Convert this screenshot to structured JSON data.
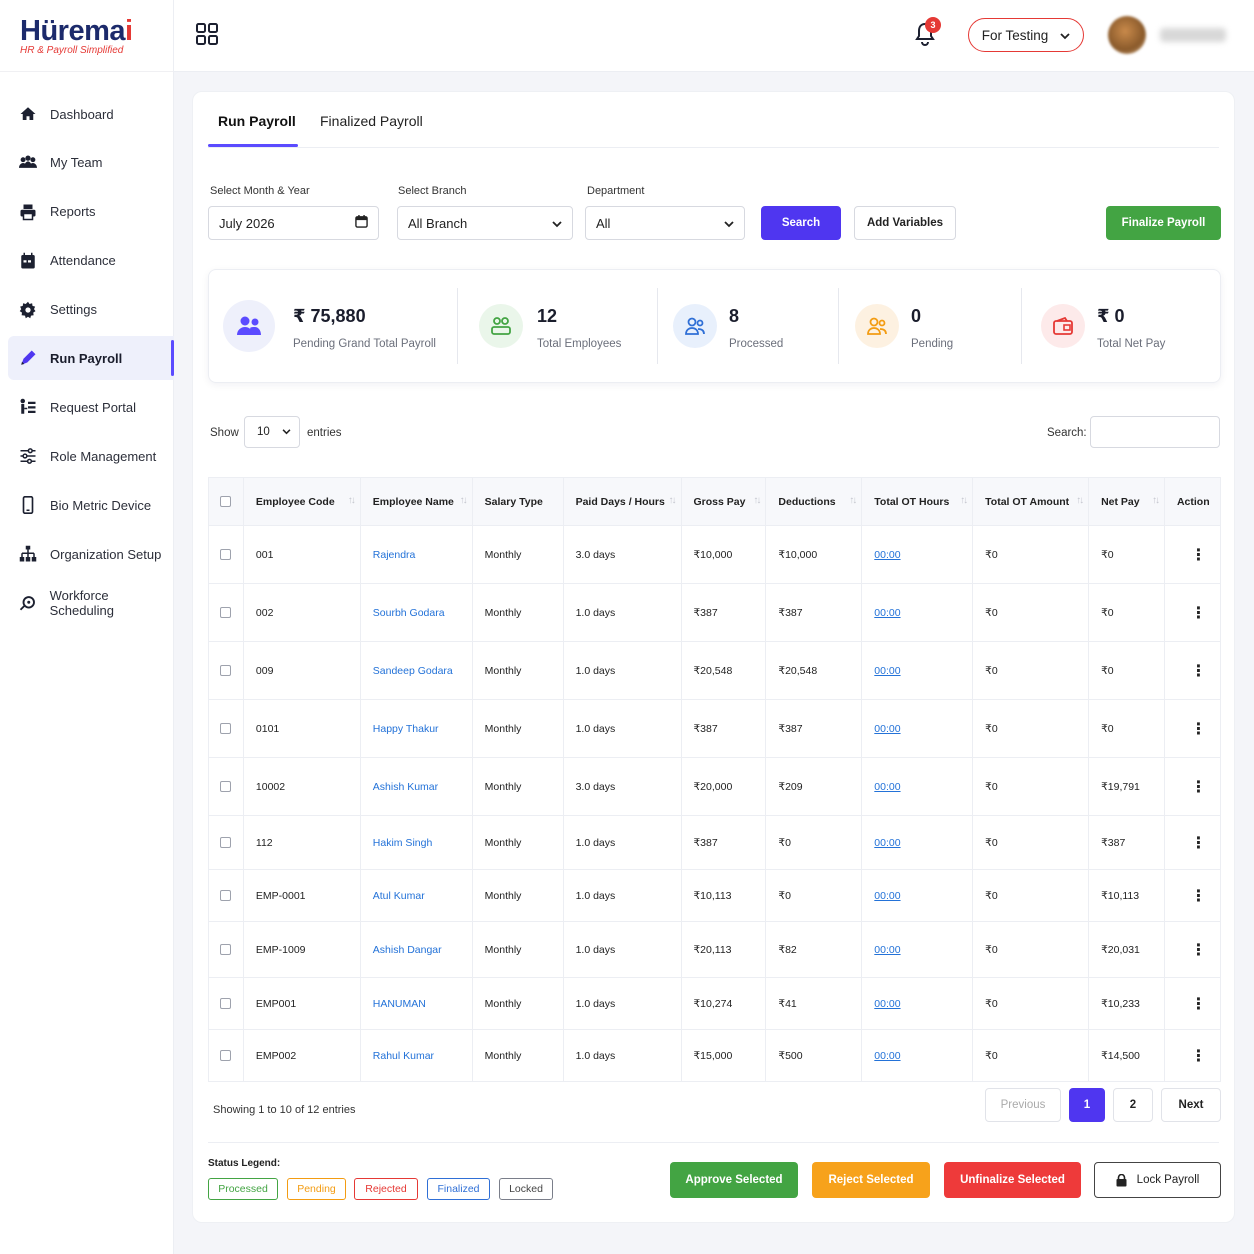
{
  "brand": {
    "logo_main": "Hürema",
    "logo_accent": "i",
    "logo_sub": "HR & Payroll Simplified",
    "accent": "#4f36f0"
  },
  "sidebar": {
    "items": [
      {
        "label": "Dashboard",
        "icon": "home-icon"
      },
      {
        "label": "My Team",
        "icon": "team-icon"
      },
      {
        "label": "Reports",
        "icon": "printer-icon"
      },
      {
        "label": "Attendance",
        "icon": "calendar-icon"
      },
      {
        "label": "Settings",
        "icon": "gear-icon"
      },
      {
        "label": "Run Payroll",
        "icon": "pen-icon",
        "active": true
      },
      {
        "label": "Request Portal",
        "icon": "request-icon"
      },
      {
        "label": "Role Management",
        "icon": "sliders-icon"
      },
      {
        "label": "Bio Metric Device",
        "icon": "device-icon"
      },
      {
        "label": "Organization Setup",
        "icon": "org-icon"
      },
      {
        "label": "Workforce Scheduling",
        "icon": "schedule-icon"
      }
    ]
  },
  "header": {
    "notifications": "3",
    "company": "For Testing"
  },
  "tabs": {
    "run": "Run Payroll",
    "finalized": "Finalized Payroll"
  },
  "filters": {
    "month_label": "Select Month & Year",
    "month_value": "July 2026",
    "branch_label": "Select Branch",
    "branch_value": "All Branch",
    "dept_label": "Department",
    "dept_value": "All",
    "search_btn": "Search",
    "vars_btn": "Add Variables",
    "finalize_btn": "Finalize Payroll"
  },
  "stats": [
    {
      "value": "₹ 75,880",
      "label": "Pending Grand Total Payroll",
      "color": "#5b4bff",
      "bg": "#eef0fb"
    },
    {
      "value": "12",
      "label": "Total Employees",
      "color": "#43a443",
      "bg": "#eaf6ea"
    },
    {
      "value": "8",
      "label": "Processed",
      "color": "#2f6fd6",
      "bg": "#e8f0fc"
    },
    {
      "value": "0",
      "label": "Pending",
      "color": "#f39c12",
      "bg": "#fdf1e1"
    },
    {
      "value": "₹ 0",
      "label": "Total Net Pay",
      "color": "#e53935",
      "bg": "#fdeaea"
    }
  ],
  "table_controls": {
    "show": "Show",
    "entries_value": "10",
    "entries": "entries",
    "search": "Search:"
  },
  "table": {
    "headers": [
      "Employee Code",
      "Employee Name",
      "Salary Type",
      "Paid Days / Hours",
      "Gross Pay",
      "Deductions",
      "Total OT Hours",
      "Total OT Amount",
      "Net Pay",
      "Action"
    ],
    "rows": [
      [
        "001",
        "Rajendra",
        "Monthly",
        "3.0 days",
        "₹10,000",
        "₹10,000",
        "00:00",
        "₹0",
        "₹0"
      ],
      [
        "002",
        "Sourbh Godara",
        "Monthly",
        "1.0 days",
        "₹387",
        "₹387",
        "00:00",
        "₹0",
        "₹0"
      ],
      [
        "009",
        "Sandeep Godara",
        "Monthly",
        "1.0 days",
        "₹20,548",
        "₹20,548",
        "00:00",
        "₹0",
        "₹0"
      ],
      [
        "0101",
        "Happy Thakur",
        "Monthly",
        "1.0 days",
        "₹387",
        "₹387",
        "00:00",
        "₹0",
        "₹0"
      ],
      [
        "10002",
        "Ashish Kumar",
        "Monthly",
        "3.0 days",
        "₹20,000",
        "₹209",
        "00:00",
        "₹0",
        "₹19,791"
      ],
      [
        "112",
        "Hakim Singh",
        "Monthly",
        "1.0 days",
        "₹387",
        "₹0",
        "00:00",
        "₹0",
        "₹387"
      ],
      [
        "EMP-0001",
        "Atul Kumar",
        "Monthly",
        "1.0 days",
        "₹10,113",
        "₹0",
        "00:00",
        "₹0",
        "₹10,113"
      ],
      [
        "EMP-1009",
        "Ashish Dangar",
        "Monthly",
        "1.0 days",
        "₹20,113",
        "₹82",
        "00:00",
        "₹0",
        "₹20,031"
      ],
      [
        "EMP001",
        "HANUMAN",
        "Monthly",
        "1.0 days",
        "₹10,274",
        "₹41",
        "00:00",
        "₹0",
        "₹10,233"
      ],
      [
        "EMP002",
        "Rahul Kumar",
        "Monthly",
        "1.0 days",
        "₹15,000",
        "₹500",
        "00:00",
        "₹0",
        "₹14,500"
      ]
    ]
  },
  "pagination": {
    "showing": "Showing 1 to 10 of 12 entries",
    "previous": "Previous",
    "page1": "1",
    "page2": "2",
    "next": "Next"
  },
  "legend": {
    "title": "Status Legend:",
    "chips": [
      {
        "label": "Processed",
        "color": "#43a443"
      },
      {
        "label": "Pending",
        "color": "#f39c12"
      },
      {
        "label": "Rejected",
        "color": "#e53935"
      },
      {
        "label": "Finalized",
        "color": "#2f6fd6"
      },
      {
        "label": "Locked",
        "color": "#7a7e8a"
      }
    ]
  },
  "actions": {
    "approve": "Approve Selected",
    "reject": "Reject Selected",
    "unfinalize": "Unfinalize Selected",
    "lock": "Lock Payroll"
  }
}
